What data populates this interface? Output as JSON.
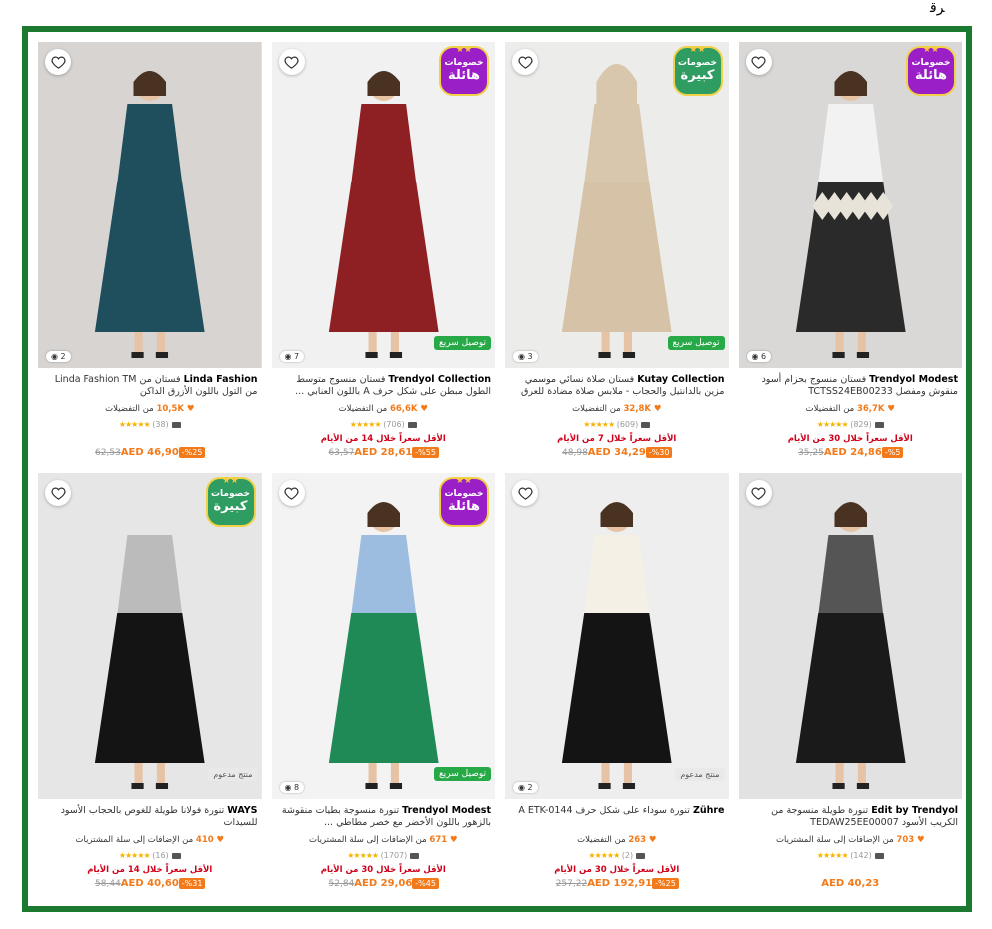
{
  "corner_mark": "ﺮﻗ",
  "colors": {
    "accent": "#f27a1a",
    "frame": "#1b7a2f",
    "badge_purple": "#9a1fc7",
    "badge_green": "#2f9c62",
    "ship": "#27a948"
  },
  "products": [
    {
      "brand": "Trendyol Modest",
      "name": "فستان منسوج بحزام أسود منقوش ومفصل TCTSS24EB00233",
      "fav_count": "36,7K",
      "fav_text": "من التفضيلات",
      "rating_count": "(829)",
      "lowest": "الأقل سعراً خلال 30 من الأيام",
      "old_price": "35,25",
      "new_price": "AED 24,86",
      "discount": "-%5",
      "badge_l1": "خصومات",
      "badge_l2": "هائلة",
      "badge_type": "purple",
      "ship": "",
      "tag": "",
      "counter": "6"
    },
    {
      "brand": "Kutay Collection",
      "name": "فستان صلاة نسائي موسمي مزين بالدانتيل والحجاب - ملابس صلاة مضادة للعرق",
      "fav_count": "32,8K",
      "fav_text": "من التفضيلات",
      "rating_count": "(609)",
      "lowest": "الأقل سعراً خلال 7 من الأيام",
      "old_price": "48,98",
      "new_price": "AED 34,29",
      "discount": "-%30",
      "badge_l1": "خصومات",
      "badge_l2": "كبيرة",
      "badge_type": "green",
      "ship": "توصيل سريع",
      "tag": "",
      "counter": "3"
    },
    {
      "brand": "Trendyol Collection",
      "name": "فستان منسوج متوسط الطول مبطن على شكل حرف A باللون العنابي ...",
      "fav_count": "66,6K",
      "fav_text": "من التفضيلات",
      "rating_count": "(706)",
      "lowest": "الأقل سعراً خلال 14 من الأيام",
      "old_price": "63,57",
      "new_price": "AED 28,61",
      "discount": "-%55",
      "badge_l1": "خصومات",
      "badge_l2": "هائلة",
      "badge_type": "purple",
      "ship": "توصيل سريع",
      "tag": "",
      "counter": "7"
    },
    {
      "brand": "Linda Fashion",
      "name": "فستان من Linda Fashion TM من التول باللون الأزرق الداكن",
      "fav_count": "10,5K",
      "fav_text": "من التفضيلات",
      "rating_count": "(38)",
      "lowest": "",
      "old_price": "62,53",
      "new_price": "AED 46,90",
      "discount": "-%25",
      "badge_l1": "",
      "badge_l2": "",
      "badge_type": "",
      "ship": "",
      "tag": "",
      "counter": "2"
    },
    {
      "brand": "Edit by Trendyol",
      "name": "تنورة طويلة منسوجة من الكريب الأسود TEDAW25EE00007",
      "fav_count": "703",
      "fav_text": "من الإضافات إلى سلة المشتريات",
      "rating_count": "(142)",
      "lowest": "",
      "old_price": "",
      "new_price": "AED 40,23",
      "discount": "",
      "badge_l1": "",
      "badge_l2": "",
      "badge_type": "",
      "ship": "",
      "tag": "",
      "counter": ""
    },
    {
      "brand": "Zühre",
      "name": "تنورة سوداء على شكل حرف A ETK-0144",
      "fav_count": "263",
      "fav_text": "من التفضيلات",
      "rating_count": "(2)",
      "lowest": "الأقل سعراً خلال 30 من الأيام",
      "old_price": "257,22",
      "new_price": "AED 192,91",
      "discount": "-%25",
      "badge_l1": "",
      "badge_l2": "",
      "badge_type": "",
      "ship": "",
      "tag": "منتج مدعوم",
      "counter": "2"
    },
    {
      "brand": "Trendyol Modest",
      "name": "تنورة منسوجة بطيات منقوشة بالزهور باللون الأخضر مع خصر مطاطي ...",
      "fav_count": "671",
      "fav_text": "من الإضافات إلى سلة المشتريات",
      "rating_count": "(1707)",
      "lowest": "الأقل سعراً خلال 30 من الأيام",
      "old_price": "52,84",
      "new_price": "AED 29,06",
      "discount": "-%45",
      "badge_l1": "خصومات",
      "badge_l2": "هائلة",
      "badge_type": "purple",
      "ship": "توصيل سريع",
      "tag": "",
      "counter": "8"
    },
    {
      "brand": "WAYS",
      "name": "تنورة فولانا طويلة للغوص بالحجاب الأسود للسيدات",
      "fav_count": "410",
      "fav_text": "من الإضافات إلى سلة المشتريات",
      "rating_count": "(16)",
      "lowest": "الأقل سعراً خلال 14 من الأيام",
      "old_price": "58,44",
      "new_price": "AED 40,60",
      "discount": "-%31",
      "badge_l1": "خصومات",
      "badge_l2": "كبيرة",
      "badge_type": "green",
      "ship": "",
      "tag": "منتج مدعوم",
      "counter": ""
    }
  ]
}
